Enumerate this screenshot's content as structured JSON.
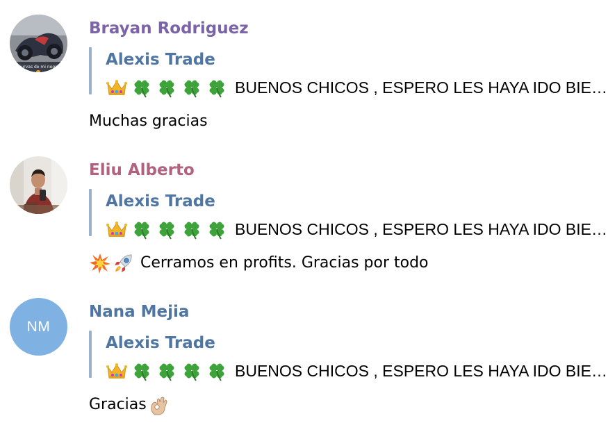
{
  "messages": [
    {
      "sender": "Brayan Rodriguez",
      "sender_color": "#7b63a8",
      "avatar": {
        "type": "photo",
        "caption": "curvas de mi nega"
      },
      "reply": {
        "author": "Alexis Trade",
        "emoji_prefix": [
          "crown-icon",
          "clover-icon",
          "clover-icon",
          "clover-icon",
          "clover-icon"
        ],
        "text": "BUENOS CHICOS , ESPERO LES HAYA IDO BIE…"
      },
      "body": {
        "text": "Muchas gracias",
        "emoji_prefix": [],
        "emoji_suffix": []
      }
    },
    {
      "sender": "Eliu Alberto",
      "sender_color": "#b0627e",
      "avatar": {
        "type": "photo"
      },
      "reply": {
        "author": "Alexis Trade",
        "emoji_prefix": [
          "crown-icon",
          "clover-icon",
          "clover-icon",
          "clover-icon",
          "clover-icon"
        ],
        "text": "BUENOS CHICOS , ESPERO LES HAYA IDO BIE…"
      },
      "body": {
        "text": "Cerramos en profits. Gracias por todo",
        "emoji_prefix": [
          "collision-icon",
          "rocket-icon"
        ],
        "emoji_suffix": []
      }
    },
    {
      "sender": "Nana Mejia",
      "sender_color": "#4f76a2",
      "avatar": {
        "type": "initials",
        "initials": "NM",
        "color": "#7fb2e3"
      },
      "reply": {
        "author": "Alexis Trade",
        "emoji_prefix": [
          "crown-icon",
          "clover-icon",
          "clover-icon",
          "clover-icon",
          "clover-icon"
        ],
        "text": "BUENOS CHICOS , ESPERO LES HAYA IDO BIE…"
      },
      "body": {
        "text": "Gracias",
        "emoji_prefix": [],
        "emoji_suffix": [
          "ok-hand-icon"
        ]
      }
    }
  ]
}
